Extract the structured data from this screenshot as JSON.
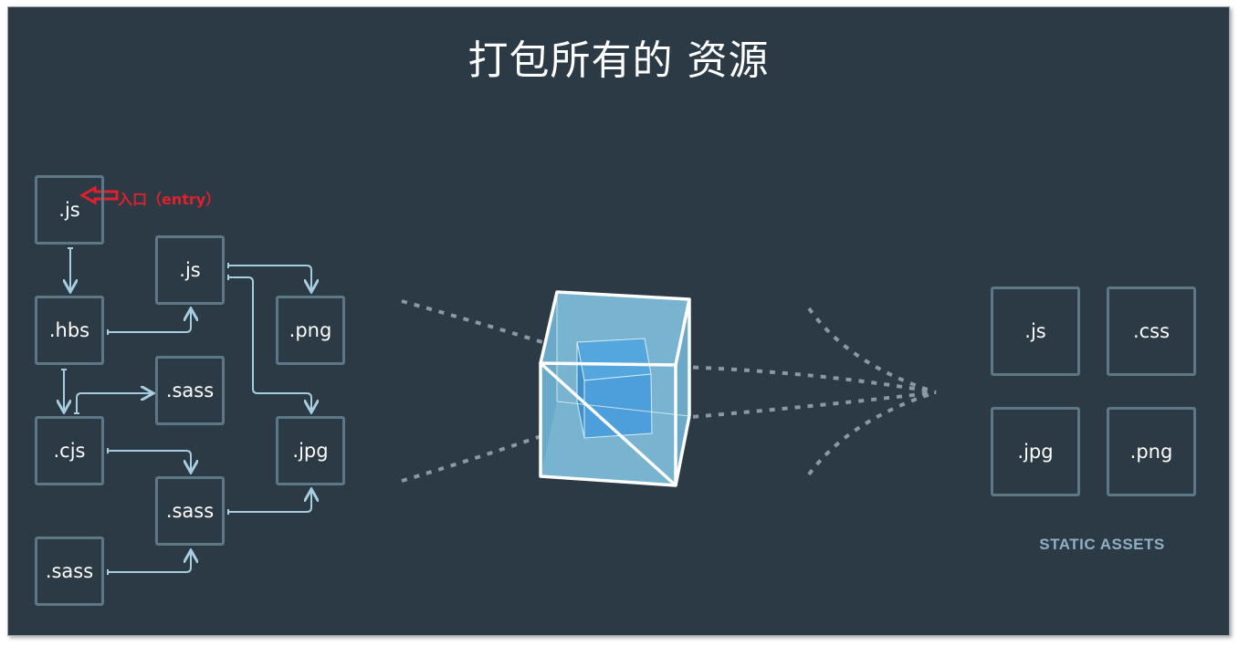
{
  "title": "打包所有的 资源",
  "entry_label": "入口（entry）",
  "source_modules": [
    ".js",
    ".hbs",
    ".cjs",
    ".sass",
    ".js",
    ".sass",
    ".sass",
    ".png",
    ".jpg"
  ],
  "output_assets": [
    ".js",
    ".css",
    ".jpg",
    ".png"
  ],
  "static_assets_label": "STATIC ASSETS",
  "colors": {
    "background": "#2b3a44",
    "box_border": "#5c7786",
    "arrow": "#a7cde0",
    "entry_red": "#e0202a",
    "bundle_cube": "#6fb1d4"
  }
}
